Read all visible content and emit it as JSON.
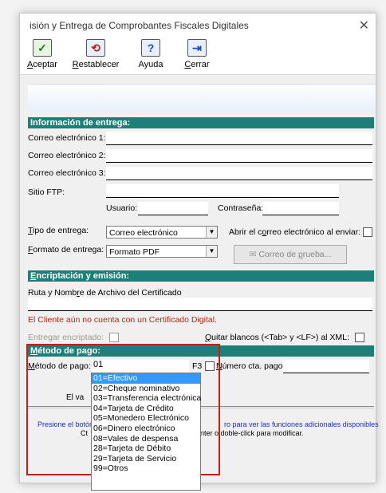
{
  "window": {
    "title": "isión y Entrega de Comprobantes Fiscales Digitales",
    "close_glyph": "✕"
  },
  "toolbar": {
    "aceptar": {
      "first": "A",
      "rest": "ceptar"
    },
    "restablecer": {
      "first": "R",
      "rest": "establecer"
    },
    "ayuda": "Ayuda",
    "cerrar": {
      "first": "C",
      "rest": "errar"
    }
  },
  "entrega": {
    "header": "Información de entrega:",
    "correo1": "Correo electrónico 1:",
    "correo2": "Correo electrónico 2:",
    "correo3": "Correo electrónico 3:",
    "sitio_ftp": "Sitio FTP:",
    "usuario": "Usuario:",
    "contrasena": "Contraseña:",
    "tipo_entrega_label": {
      "first": "T",
      "rest": "ipo de entrega:"
    },
    "tipo_entrega_value": "Correo electrónico",
    "abrir_correo": {
      "pre": "Abrir el c",
      "u": "o",
      "post": "rreo electrónico al enviar:"
    },
    "formato_label": {
      "first": "F",
      "rest": "ormato de entrega:"
    },
    "formato_value": "Formato PDF",
    "correo_prueba": {
      "pre": "Correo de ",
      "u": "p",
      "post": "rueba..."
    }
  },
  "encriptacion": {
    "header": {
      "first": "E",
      "rest": "ncriptación y emisión:"
    },
    "ruta": {
      "pre": "Ruta y Nomb",
      "u": "r",
      "post": "e de Archivo del Certificado"
    },
    "warning": "El Cliente aún no cuenta con un Certificado Digital.",
    "entregar": "Entregar encriptado:",
    "quitar": {
      "first": "Q",
      "rest": "uitar blancos (<Tab> y <LF>) al  XML:"
    }
  },
  "pago": {
    "header": {
      "first": "M",
      "rest": "étodo de pago:"
    },
    "metodo_label": {
      "first": "M",
      "rest": "étodo de pago:"
    },
    "metodo_value": "01",
    "f3": "F3",
    "numero_cta": {
      "first": "N",
      "rest": "úmero cta. pago:"
    },
    "options": [
      "01=Efectivo",
      "02=Cheque nominativo",
      "03=Transferencia electrónica",
      "04=Tarjeta de Crédito",
      "05=Monedero Electrónico",
      "06=Dinero electrónico",
      "08=Vales de despensa",
      "28=Tarjeta de Débito",
      "29=Tarjeta de Servicio",
      "99=Otros"
    ],
    "selected_index": 0
  },
  "footer": {
    "el_va": "El va",
    "presione_left": "Presione el botón",
    "presione_right": "ro para ver las funciones adicionales disponibles",
    "ct": "Ct",
    "enter": "Enter o doble-click para modificar."
  },
  "colors": {
    "section": "#1c8078",
    "highlight": "#3399ff",
    "warning": "#c0201a",
    "redbox": "#c0201a"
  }
}
